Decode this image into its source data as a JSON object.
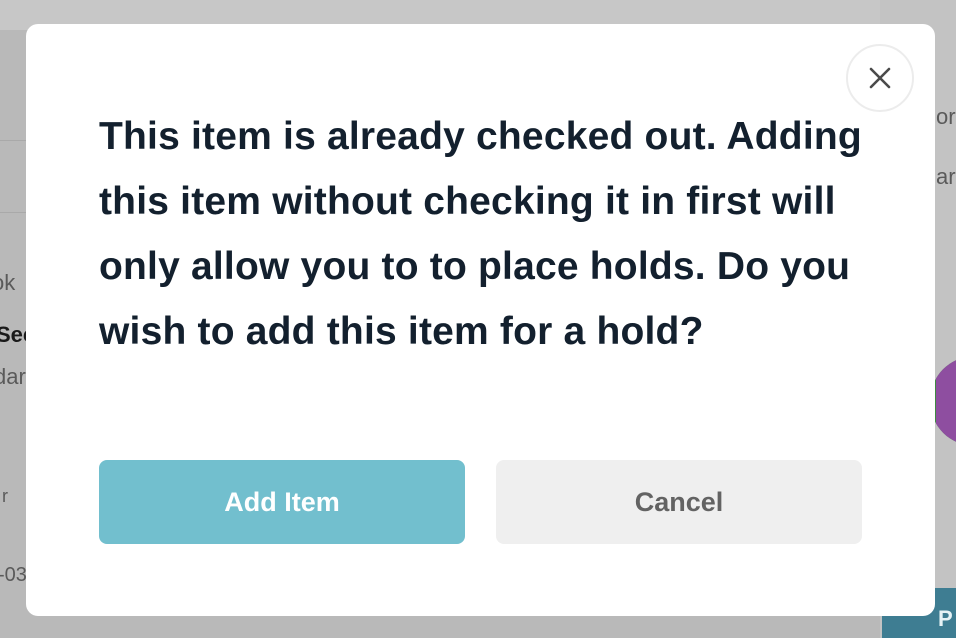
{
  "dialog": {
    "message": "This item is already checked out. Adding this item without checking it in first will only allow you to to place holds. Do you wish to add this item for a hold?",
    "primary_button_label": "Add Item",
    "secondary_button_label": "Cancel",
    "close_icon": "close-icon"
  },
  "background_page": {
    "fragments": [
      "ok",
      "Sec",
      "dar",
      "r",
      "-03",
      "or",
      "ar",
      "P"
    ]
  },
  "colors": {
    "primary_button": "#72bfce",
    "secondary_button": "#efefef",
    "message_text": "#13202e",
    "overlay": "#b9b9b9"
  }
}
